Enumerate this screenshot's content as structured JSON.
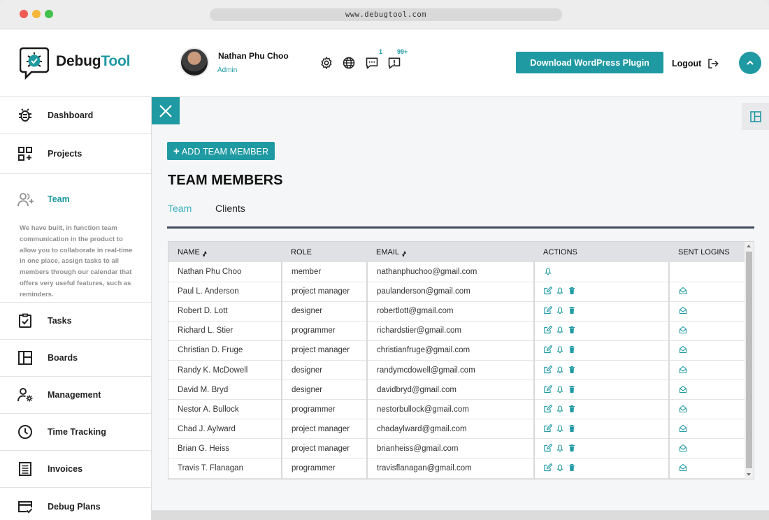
{
  "browser": {
    "url": "www.debugtool.com",
    "dots": [
      "#ee5b55",
      "#f5b63c",
      "#43c14e"
    ]
  },
  "header": {
    "brand_prefix": "Debug",
    "brand_suffix": "Tool",
    "user_name": "Nathan Phu Choo",
    "user_role": "Admin",
    "messages_badge": "1",
    "notifications_badge": "99+",
    "download_label": "Download WordPress Plugin",
    "logout_label": "Logout"
  },
  "sidebar": {
    "items": [
      {
        "label": "Dashboard",
        "icon": "bug-icon"
      },
      {
        "label": "Projects",
        "icon": "apps-add-icon"
      },
      {
        "label": "Team",
        "icon": "team-add-icon"
      },
      {
        "label": "Tasks",
        "icon": "clipboard-check-icon"
      },
      {
        "label": "Boards",
        "icon": "board-icon"
      },
      {
        "label": "Management",
        "icon": "user-gear-icon"
      },
      {
        "label": "Time Tracking",
        "icon": "clock-icon"
      },
      {
        "label": "Invoices",
        "icon": "invoice-icon"
      },
      {
        "label": "Debug Plans",
        "icon": "card-check-icon"
      }
    ],
    "team_description": "We have built, in function team communication in the product to allow you to collaborate in real-time in one place, assign tasks to all members through our calendar that offers very useful features, such as reminders."
  },
  "main": {
    "add_button_label": "ADD TEAM MEMBER",
    "title": "TEAM MEMBERS",
    "tabs": [
      {
        "label": "Team",
        "active": true
      },
      {
        "label": "Clients",
        "active": false
      }
    ],
    "table": {
      "columns": [
        "NAME",
        "ROLE",
        "EMAIL",
        "ACTIONS",
        "SENT LOGINS"
      ],
      "rows": [
        {
          "name": "Nathan Phu Choo",
          "role": "member",
          "email": "nathanphuchoo@gmail.com",
          "actions": [
            "bell"
          ],
          "sent_login": false
        },
        {
          "name": "Paul L. Anderson",
          "role": "project manager",
          "email": "paulanderson@gmail.com",
          "actions": [
            "edit",
            "bell",
            "trash"
          ],
          "sent_login": true
        },
        {
          "name": "Robert D. Lott",
          "role": "designer",
          "email": "robertlott@gmail.com",
          "actions": [
            "edit",
            "bell",
            "trash"
          ],
          "sent_login": true
        },
        {
          "name": "Richard L. Stier",
          "role": "programmer",
          "email": "richardstier@gmail.com",
          "actions": [
            "edit",
            "bell",
            "trash"
          ],
          "sent_login": true
        },
        {
          "name": "Christian D. Fruge",
          "role": "project manager",
          "email": "christianfruge@gmail.com",
          "actions": [
            "edit",
            "bell",
            "trash"
          ],
          "sent_login": true
        },
        {
          "name": "Randy K. McDowell",
          "role": "designer",
          "email": "randymcdowell@gmail.com",
          "actions": [
            "edit",
            "bell",
            "trash"
          ],
          "sent_login": true
        },
        {
          "name": "David M. Bryd",
          "role": "designer",
          "email": "davidbryd@gmail.com",
          "actions": [
            "edit",
            "bell",
            "trash"
          ],
          "sent_login": true
        },
        {
          "name": "Nestor A. Bullock",
          "role": "programmer",
          "email": "nestorbullock@gmail.com",
          "actions": [
            "edit",
            "bell",
            "trash"
          ],
          "sent_login": true
        },
        {
          "name": "Chad J. Aylward",
          "role": "project manager",
          "email": "chadaylward@gmail.com",
          "actions": [
            "edit",
            "bell",
            "trash"
          ],
          "sent_login": true
        },
        {
          "name": "Brian G. Heiss",
          "role": "project manager",
          "email": "brianheiss@gmail.com",
          "actions": [
            "edit",
            "bell",
            "trash"
          ],
          "sent_login": true
        },
        {
          "name": "Travis T. Flanagan",
          "role": "programmer",
          "email": "travisflanagan@gmail.com",
          "actions": [
            "edit",
            "bell",
            "trash"
          ],
          "sent_login": true
        }
      ]
    }
  },
  "colors": {
    "accent": "#1f9aa3",
    "tab_active": "#3ab0c0",
    "divider": "#3e4b5e"
  }
}
